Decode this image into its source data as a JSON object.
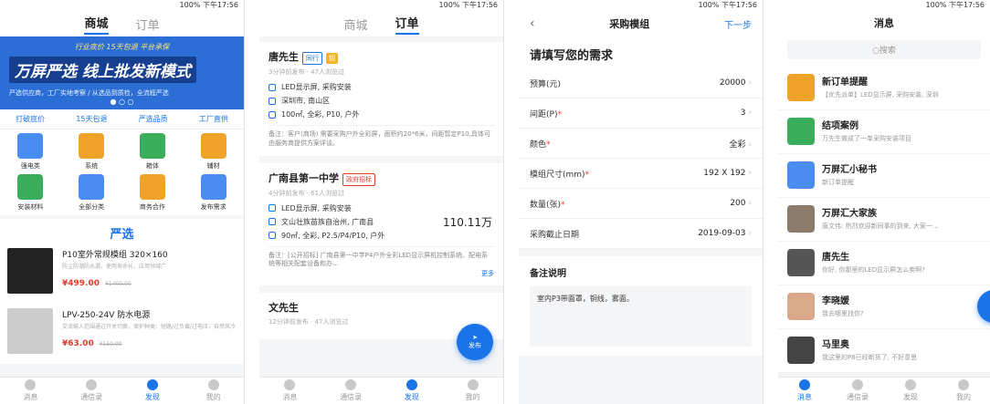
{
  "status_text": "100% 下午17:56",
  "s1": {
    "tabs": [
      "商城",
      "订单"
    ],
    "banner": {
      "slogan": "行业底价  15天包退  平台承保",
      "title": "万屏严选  线上批发新模式",
      "sub": "严选供应商，工厂实地考察 / 从选品到质检，全流程严选"
    },
    "guarantees": [
      "打破底价",
      "15天包退",
      "严选品质",
      "工厂直供"
    ],
    "categories": [
      {
        "label": "强电类",
        "color": "#4a8df0"
      },
      {
        "label": "系统",
        "color": "#f0a329"
      },
      {
        "label": "箱体",
        "color": "#3aae5a"
      },
      {
        "label": "辅材",
        "color": "#f0a329"
      },
      {
        "label": "安装材料",
        "color": "#3aae5a"
      },
      {
        "label": "全部分类",
        "color": "#4a8df0"
      },
      {
        "label": "商务合作",
        "color": "#f0a329"
      },
      {
        "label": "发布需求",
        "color": "#4a8df0"
      }
    ],
    "brand": "严选",
    "products": [
      {
        "title": "P10室外常规模组 320×160",
        "desc": "防尘防潮防水漏，使用寿命长，应用领域广",
        "price": "¥499.00",
        "old": "¥1400.00"
      },
      {
        "title": "LPV-250-24V 防水电源",
        "desc": "交流输入范围通过开关切换，保护种类：短路/过负载/过电压，自然风冷",
        "price": "¥63.00",
        "old": "¥150.00"
      }
    ]
  },
  "s2": {
    "tabs": [
      "商城",
      "订单"
    ],
    "orders": [
      {
        "name": "唐先生",
        "tag1": "同行",
        "tag2": "钥",
        "meta": "3分钟前发布  ·  47人浏览过",
        "l1": "LED显示屏, 采购安装",
        "l2": "深圳市, 南山区",
        "l3": "100㎡, 全彩, P10, 户外",
        "note": "备注：客户(商场) 需要采购户外全彩屏，面积约20*6米，间距暂定P10,具体可由服务商提供方案详谈。"
      },
      {
        "name": "广南县第一中学",
        "tag1": "政府招标",
        "meta": "4分钟前发布  ·  61人浏览过",
        "l1": "LED显示屏, 采购安装",
        "l2": "文山壮族苗族自治州, 广南县",
        "price": "110.11万",
        "l3": "90㎡, 全彩, P2.5/P4/P10, 户外",
        "note": "备注：[公开招标] 广南县第一中学P4户外全彩LED显示屏机控制系统、配电系统等相关配套设备和办...",
        "more": "更多"
      },
      {
        "name": "文先生",
        "meta": "12分钟前发布  ·  47人浏览过"
      }
    ],
    "fab": "发布"
  },
  "s3": {
    "title": "采购模组",
    "back": "‹",
    "next": "下一步",
    "section": "请填写您的需求",
    "fields": [
      {
        "label": "预算(元)",
        "value": "20000",
        "req": ""
      },
      {
        "label": "间距(P)",
        "value": "3",
        "req": "*"
      },
      {
        "label": "颜色",
        "value": "全彩",
        "req": "*"
      },
      {
        "label": "模组尺寸(mm)",
        "value": "192   X   192",
        "req": "*"
      },
      {
        "label": "数量(张)",
        "value": "200",
        "req": "*"
      },
      {
        "label": "采购截止日期",
        "value": "2019-09-03",
        "req": ""
      }
    ],
    "note_title": "备注说明",
    "note": "室内P3带面罩，铜线，雾面。"
  },
  "s4": {
    "title": "消息",
    "search": "○搜索",
    "msgs": [
      {
        "name": "新订单提醒",
        "preview": "【优先派单】LED显示屏, 采购安装, 深圳",
        "color": "#f0a329"
      },
      {
        "name": "结项案例",
        "preview": "万先生做成了一单采购安装项目",
        "color": "#3aae5a"
      },
      {
        "name": "万屏汇小秘书",
        "preview": "新订单提醒",
        "color": "#4a8df0"
      },
      {
        "name": "万屏汇大家族",
        "preview": "唐文伟: 热烈欢迎新同事的到来, 大家一...",
        "color": "#8c7b6b"
      },
      {
        "name": "唐先生",
        "preview": "你好, 你那里的LED显示屏怎么卖啊?",
        "color": "#555"
      },
      {
        "name": "李晓媛",
        "preview": "我去哪里找你?",
        "color": "#d9a98a"
      },
      {
        "name": "马里奥",
        "preview": "我这里的P8已经断货了, 不好意思",
        "color": "#444"
      }
    ]
  },
  "tabbar": [
    "消息",
    "通信录",
    "发现",
    "我的"
  ]
}
